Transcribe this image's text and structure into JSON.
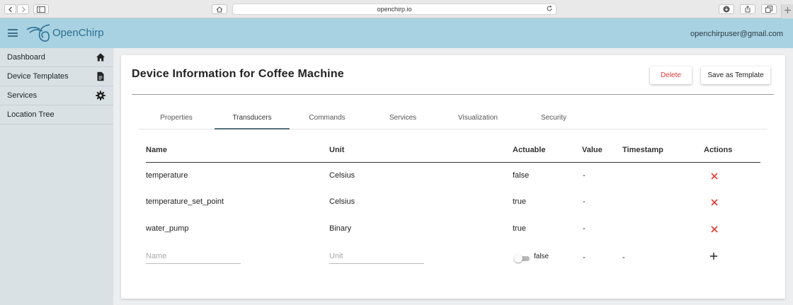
{
  "browser": {
    "url": "openchirp.io"
  },
  "header": {
    "brand": "OpenChirp",
    "user_email": "openchirpuser@gmail.com"
  },
  "sidebar": {
    "items": [
      {
        "label": "Dashboard",
        "icon": "home-icon"
      },
      {
        "label": "Device Templates",
        "icon": "document-icon"
      },
      {
        "label": "Services",
        "icon": "gear-icon"
      },
      {
        "label": "Location Tree",
        "icon": ""
      }
    ]
  },
  "main": {
    "title": "Device Information for Coffee Machine",
    "delete_label": "Delete",
    "save_template_label": "Save as Template",
    "tabs": [
      {
        "label": "Properties",
        "active": false
      },
      {
        "label": "Transducers",
        "active": true
      },
      {
        "label": "Commands",
        "active": false
      },
      {
        "label": "Services",
        "active": false
      },
      {
        "label": "Visualization",
        "active": false
      },
      {
        "label": "Security",
        "active": false
      }
    ],
    "table": {
      "columns": [
        "Name",
        "Unit",
        "Actuable",
        "Value",
        "Timestamp",
        "Actions"
      ],
      "rows": [
        {
          "name": "temperature",
          "unit": "Celsius",
          "actuable": "false",
          "value": "-",
          "timestamp": ""
        },
        {
          "name": "temperature_set_point",
          "unit": "Celsius",
          "actuable": "true",
          "value": "-",
          "timestamp": ""
        },
        {
          "name": "water_pump",
          "unit": "Binary",
          "actuable": "true",
          "value": "-",
          "timestamp": ""
        }
      ],
      "new_row": {
        "name_placeholder": "Name",
        "unit_placeholder": "Unit",
        "actuable_label": "false",
        "value": "-",
        "timestamp": "-"
      }
    }
  },
  "colors": {
    "appbar": "#a8d2e1",
    "sidebar": "#d9e1e5",
    "delete": "#e53935",
    "accent": "#546e7a"
  }
}
